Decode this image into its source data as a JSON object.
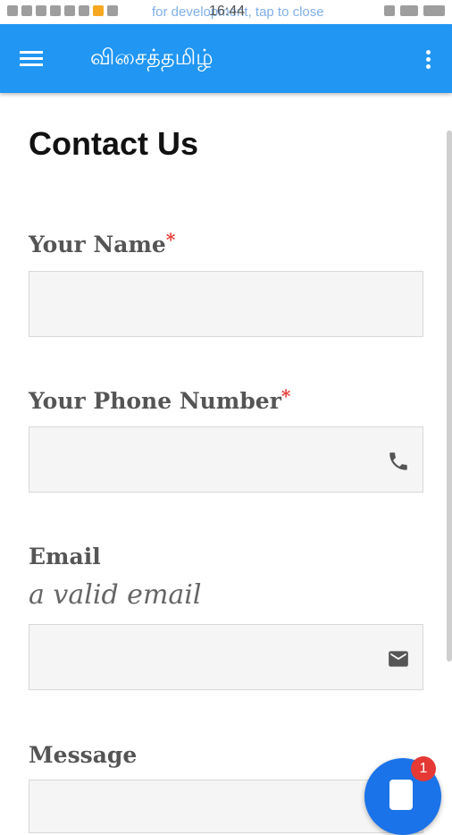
{
  "status_bar": {
    "time": "16:44",
    "notice": "for development, tap to close"
  },
  "app_bar": {
    "title": "விசைத்தமிழ்"
  },
  "page": {
    "title": "Contact Us"
  },
  "form": {
    "name_label": "Your Name",
    "phone_label": "Your Phone Number",
    "email_label": "Email",
    "email_hint": "a valid email",
    "message_label": "Message",
    "required_mark": "*",
    "name_value": "",
    "phone_value": "",
    "email_value": ""
  },
  "chat_badge": {
    "count": "1"
  },
  "colors": {
    "app_bar": "#2196f3",
    "required": "#e53935",
    "fab": "#1a73e8"
  }
}
